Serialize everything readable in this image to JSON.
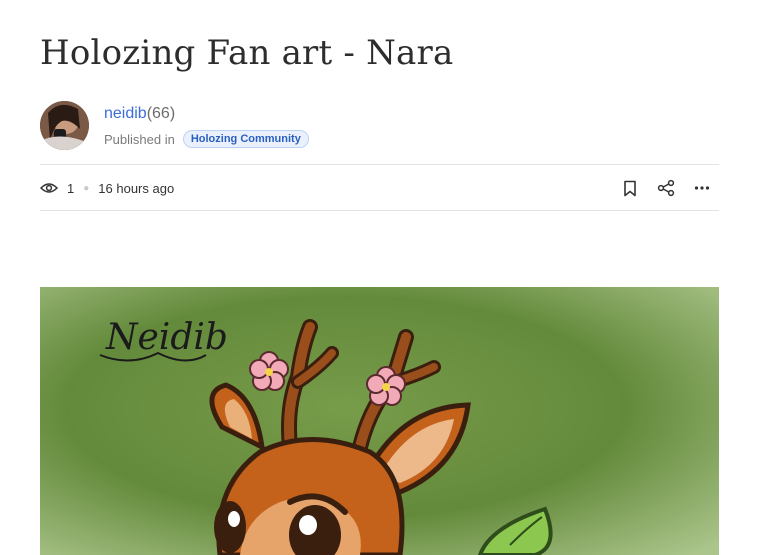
{
  "post": {
    "title": "Holozing Fan art - Nara",
    "author": "neidib",
    "reputation": "(66)",
    "published_in_label": "Published in",
    "community": "Holozing Community",
    "views": "1",
    "time_ago": "16 hours ago"
  },
  "image": {
    "signature_text": "Neidib"
  },
  "icons": {
    "views": "eye-icon",
    "bookmark": "bookmark-icon",
    "share": "share-icon",
    "more": "more-horizontal-icon"
  },
  "colors": {
    "link": "#3b6ed8",
    "badge_bg": "#eaf1fd",
    "badge_text": "#2a5fc2",
    "divider": "#e3e3e3"
  }
}
